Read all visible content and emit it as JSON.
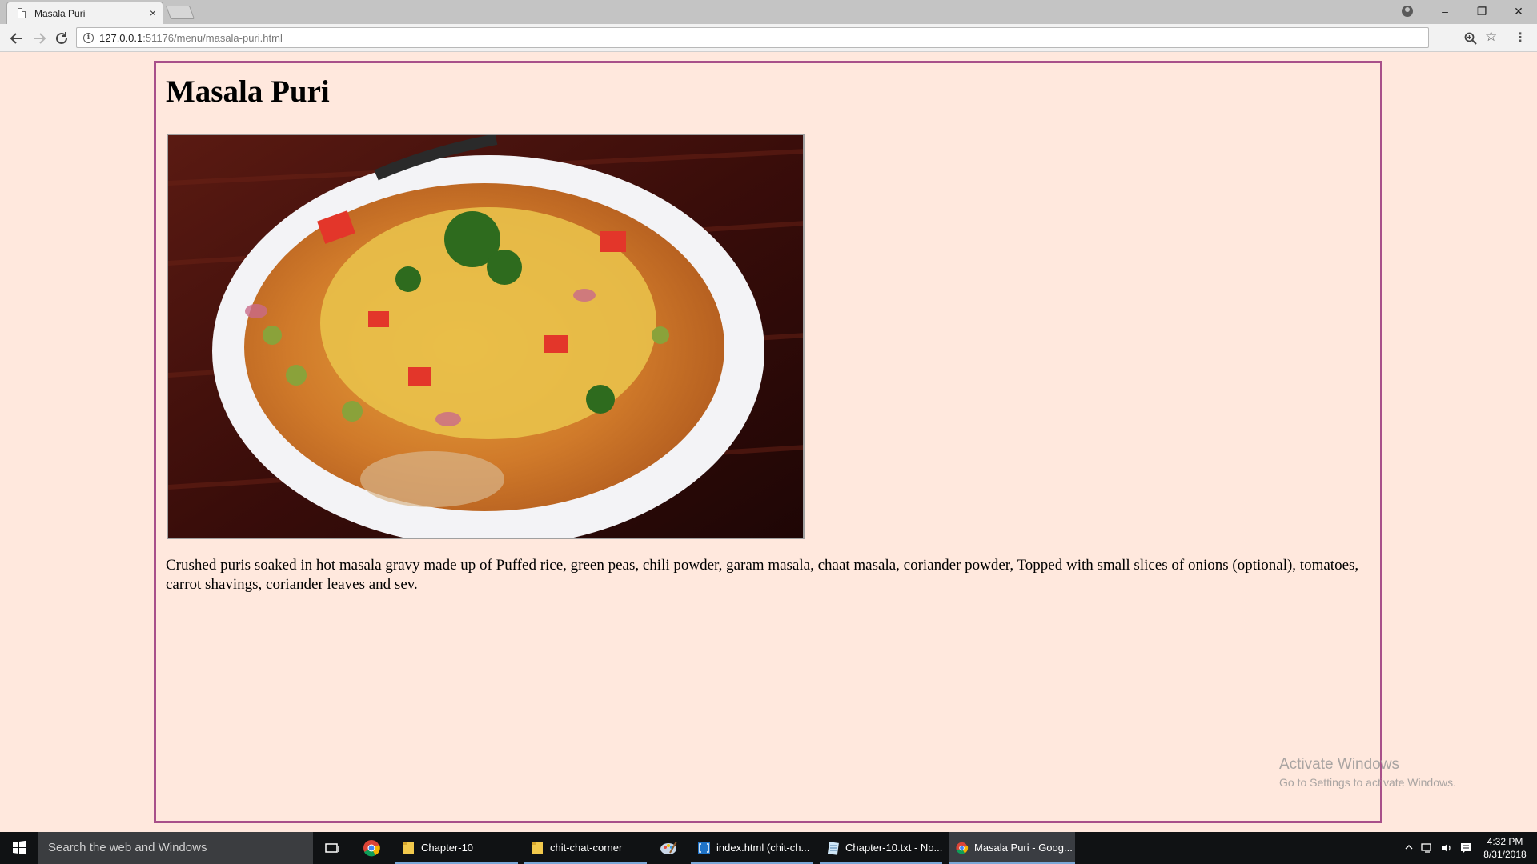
{
  "browser": {
    "tab_title": "Masala Puri",
    "tab_close": "×",
    "url_host": "127.0.0.1",
    "url_rest": ":51176/menu/masala-puri.html",
    "window_controls": {
      "minimize": "–",
      "restore": "❐",
      "close": "✕"
    }
  },
  "page": {
    "title": "Masala Puri",
    "image_alt": "Masala Puri dish",
    "description": "Crushed puris soaked in hot masala gravy made up of Puffed rice, green peas, chili powder, garam masala, chaat masala, coriander powder, Topped with small slices of onions (optional), tomatoes, carrot shavings, coriander leaves and sev."
  },
  "watermark": {
    "line1": "Activate Windows",
    "line2": "Go to Settings to activate Windows."
  },
  "taskbar": {
    "search_placeholder": "Search the web and Windows",
    "items": [
      {
        "label": "Chapter-10",
        "icon": "folder-icon"
      },
      {
        "label": "chit-chat-corner",
        "icon": "folder-icon"
      },
      {
        "label": "index.html (chit-ch...",
        "icon": "brackets-icon"
      },
      {
        "label": "Chapter-10.txt - No...",
        "icon": "notepad-icon"
      },
      {
        "label": "Masala Puri - Goog...",
        "icon": "chrome-icon"
      }
    ],
    "clock_time": "4:32 PM",
    "clock_date": "8/31/2018"
  },
  "colors": {
    "page_background": "#ffe8dd",
    "frame_border": "#a8508a"
  }
}
